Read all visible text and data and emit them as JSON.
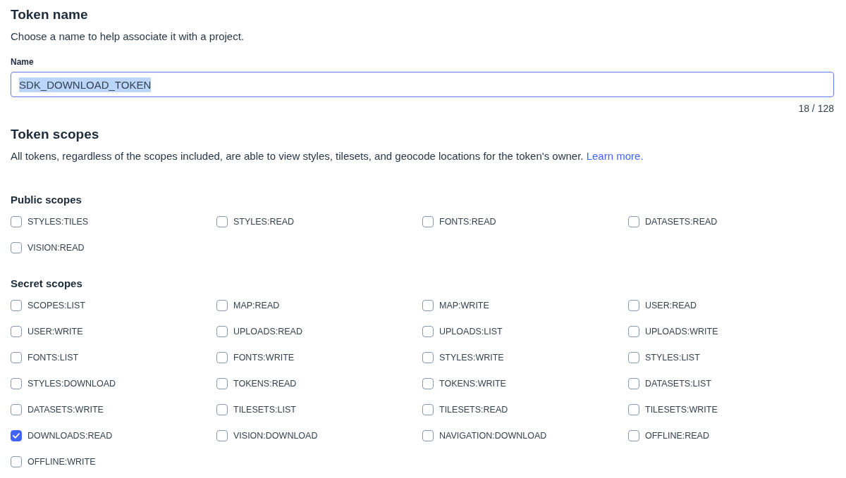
{
  "token_name": {
    "title": "Token name",
    "description": "Choose a name to help associate it with a project.",
    "field_label": "Name",
    "value": "SDK_DOWNLOAD_TOKEN",
    "value_highlighted": true,
    "char_count": "18 / 128"
  },
  "token_scopes": {
    "title": "Token scopes",
    "description": "All tokens, regardless of the scopes included, are able to view styles, tilesets, and geocode locations for the token's owner.",
    "link": "Learn more."
  },
  "groups": [
    {
      "title": "Public scopes",
      "scopes": [
        {
          "label": "STYLES:TILES",
          "checked": false
        },
        {
          "label": "STYLES:READ",
          "checked": false
        },
        {
          "label": "FONTS:READ",
          "checked": false
        },
        {
          "label": "DATASETS:READ",
          "checked": false
        },
        {
          "label": "VISION:READ",
          "checked": false
        }
      ]
    },
    {
      "title": "Secret scopes",
      "scopes": [
        {
          "label": "SCOPES:LIST",
          "checked": false
        },
        {
          "label": "MAP:READ",
          "checked": false
        },
        {
          "label": "MAP:WRITE",
          "checked": false
        },
        {
          "label": "USER:READ",
          "checked": false
        },
        {
          "label": "USER:WRITE",
          "checked": false
        },
        {
          "label": "UPLOADS:READ",
          "checked": false
        },
        {
          "label": "UPLOADS:LIST",
          "checked": false
        },
        {
          "label": "UPLOADS:WRITE",
          "checked": false
        },
        {
          "label": "FONTS:LIST",
          "checked": false
        },
        {
          "label": "FONTS:WRITE",
          "checked": false
        },
        {
          "label": "STYLES:WRITE",
          "checked": false
        },
        {
          "label": "STYLES:LIST",
          "checked": false
        },
        {
          "label": "STYLES:DOWNLOAD",
          "checked": false
        },
        {
          "label": "TOKENS:READ",
          "checked": false
        },
        {
          "label": "TOKENS:WRITE",
          "checked": false
        },
        {
          "label": "DATASETS:LIST",
          "checked": false
        },
        {
          "label": "DATASETS:WRITE",
          "checked": false
        },
        {
          "label": "TILESETS:LIST",
          "checked": false
        },
        {
          "label": "TILESETS:READ",
          "checked": false
        },
        {
          "label": "TILESETS:WRITE",
          "checked": false
        },
        {
          "label": "DOWNLOADS:READ",
          "checked": true
        },
        {
          "label": "VISION:DOWNLOAD",
          "checked": false
        },
        {
          "label": "NAVIGATION:DOWNLOAD",
          "checked": false
        },
        {
          "label": "OFFLINE:READ",
          "checked": false
        },
        {
          "label": "OFFLINE:WRITE",
          "checked": false
        }
      ]
    }
  ]
}
